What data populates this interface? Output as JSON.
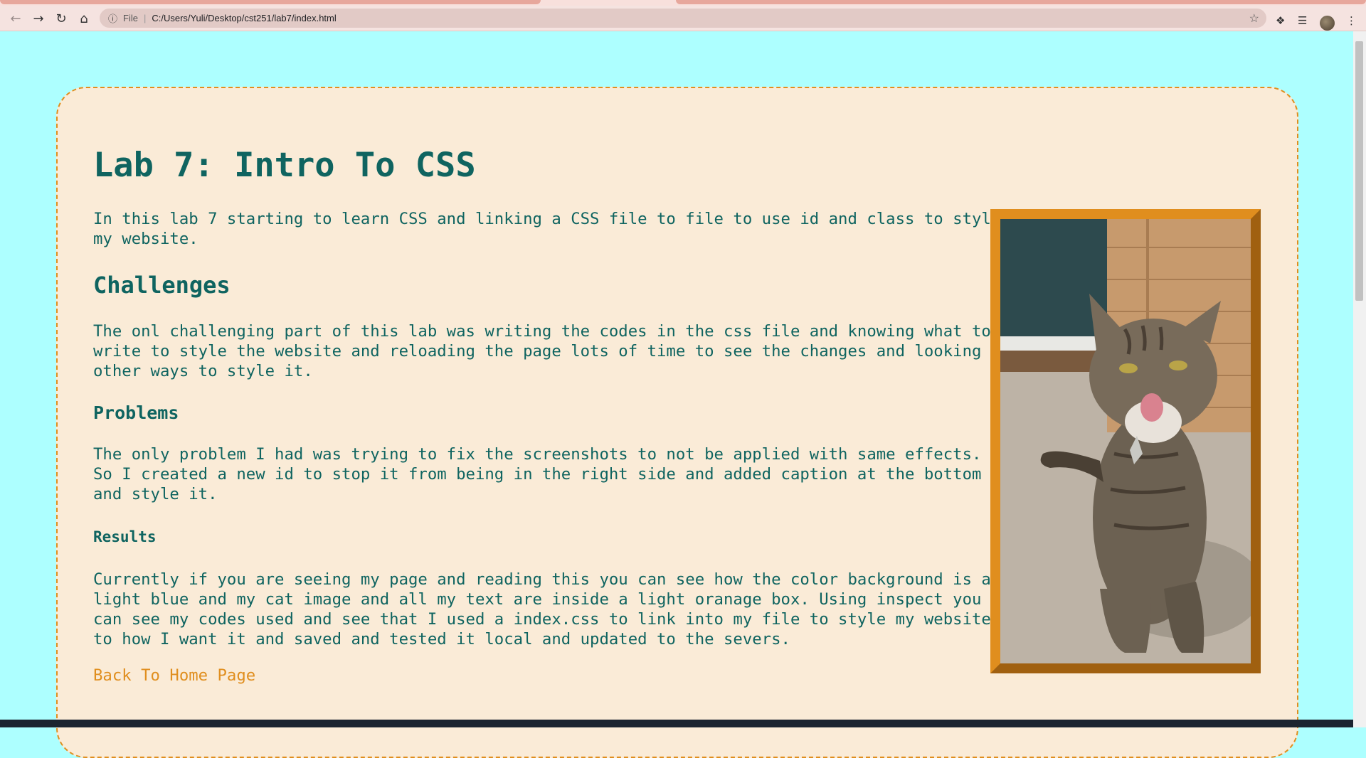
{
  "browser": {
    "file_label": "File",
    "url": "C:/Users/Yuli/Desktop/cst251/lab7/index.html",
    "icons": [
      "back-arrow-icon",
      "forward-arrow-icon",
      "reload-icon",
      "home-icon",
      "info-icon",
      "star-icon",
      "extensions-puzzle-icon",
      "media-queue-icon",
      "profile-avatar",
      "menu-dots-icon"
    ]
  },
  "page": {
    "background_color": "#adffff",
    "box_color": "#faebd7",
    "text_color": "#0f6460",
    "accent_color": "#e08e1e",
    "title": "Lab 7: Intro To CSS",
    "intro": "In this lab 7 starting to learn CSS and linking a CSS file to file to use id and class to style\nmy website.",
    "challenges_heading": "Challenges",
    "challenges_text": "The onl challenging part of this lab was writing the codes in the css file and knowing what to\nwrite to style the website and reloading the page lots of time to see the changes and looking\nother ways to style it.",
    "problems_heading": "Problems",
    "problems_text": "The only problem I had was trying to fix the screenshots to not be applied with same effects.\nSo I created a new id to stop it from being in the right side and added caption at the bottom\nand style it.",
    "results_heading": "Results",
    "results_text": "Currently if you are seeing my page and reading this you can see how the color background is a\nlight blue and my cat image and all my text are inside a light oranage box. Using inspect you\ncan see my codes used and see that I used a index.css to link into my file to style my website\nto how I want it and saved and tested it local and updated to the severs.",
    "back_link": "Back To Home Page"
  }
}
